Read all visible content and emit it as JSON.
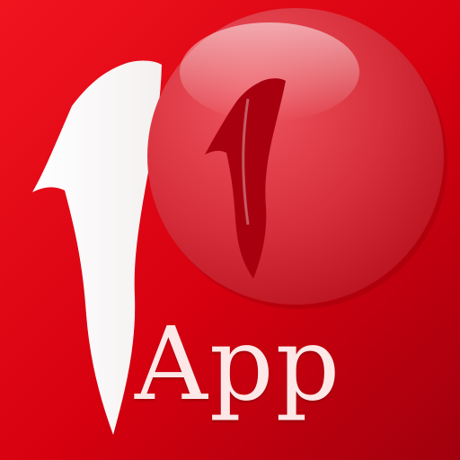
{
  "app_icon": {
    "label": "App",
    "logo_glyph": "1",
    "colors": {
      "background_light": "#e8101c",
      "background_dark": "#a1000d",
      "sphere_light": "#ef5a64",
      "sphere_dark": "#c4101c",
      "logo_fill": "#ffffff",
      "logo_in_sphere": "#a8000f",
      "label_text": "#fde7e7"
    }
  }
}
